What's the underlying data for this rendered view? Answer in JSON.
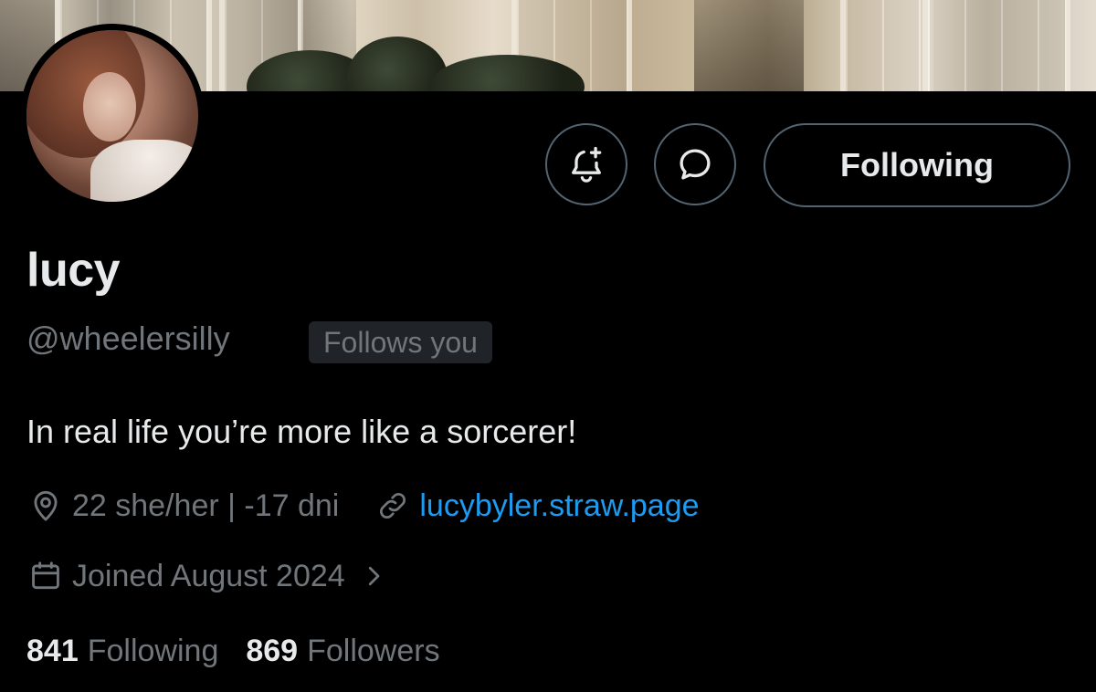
{
  "profile": {
    "display_name": "lucy",
    "handle": "@wheelersilly",
    "follows_you_badge": "Follows you",
    "bio": "In real life you’re more like a sorcerer!",
    "location": "22 she/her | -17 dni",
    "website": "lucybyler.straw.page",
    "joined": "Joined August 2024"
  },
  "actions": {
    "notify_icon": "bell-plus-icon",
    "message_icon": "chat-bubble-icon",
    "follow_button_label": "Following"
  },
  "stats": {
    "following_count": "841",
    "following_label": "Following",
    "followers_count": "869",
    "followers_label": "Followers"
  },
  "icons": {
    "location": "location-pin-icon",
    "link": "link-icon",
    "calendar": "calendar-icon",
    "chevron": "chevron-right-icon"
  },
  "colors": {
    "background": "#000000",
    "primary_text": "#e7e9ea",
    "secondary_text": "#71767b",
    "link": "#1d9bf0",
    "border": "#536471",
    "badge_bg": "#202327"
  }
}
